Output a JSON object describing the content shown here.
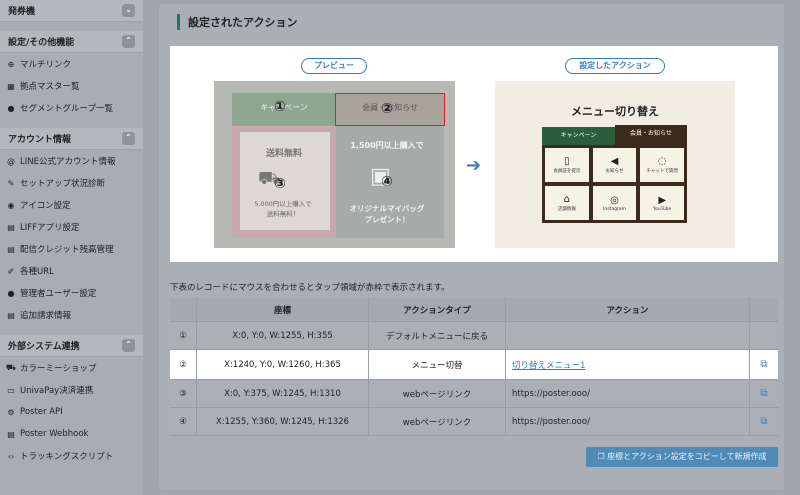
{
  "sidebar": {
    "sec_finance": {
      "label": "発券機"
    },
    "sec_settings": {
      "label": "設定/その他機能"
    },
    "settings_items": [
      {
        "label": "マルチリンク",
        "icon": "globe-icon"
      },
      {
        "label": "拠点マスター覧",
        "icon": "store-icon"
      },
      {
        "label": "セグメントグループ一覧",
        "icon": "users-icon"
      }
    ],
    "sec_account": {
      "label": "アカウント情報"
    },
    "account_items": [
      {
        "label": "LINE公式アカウント情報",
        "icon": "at-icon"
      },
      {
        "label": "セットアップ状況診断",
        "icon": "wrench-icon"
      },
      {
        "label": "アイコン設定",
        "icon": "user-circle-icon"
      },
      {
        "label": "LIFFアプリ設定",
        "icon": "document-icon"
      },
      {
        "label": "配信クレジット残高管理",
        "icon": "document-icon"
      },
      {
        "label": "各種URL",
        "icon": "edit-icon"
      },
      {
        "label": "管理者ユーザー設定",
        "icon": "users-icon"
      },
      {
        "label": "追加請求情報",
        "icon": "invoice-icon"
      }
    ],
    "sec_external": {
      "label": "外部システム連携"
    },
    "external_items": [
      {
        "label": "カラーミーショップ",
        "icon": "cart-icon"
      },
      {
        "label": "UnivaPay決済連携",
        "icon": "card-icon"
      },
      {
        "label": "Poster API",
        "icon": "gear-icon"
      },
      {
        "label": "Poster Webhook",
        "icon": "document-icon"
      },
      {
        "label": "トラッキングスクリプト",
        "icon": "code-icon"
      }
    ]
  },
  "main": {
    "title": "設定されたアクション",
    "preview_label": "プレビュー",
    "action_label": "設定したアクション",
    "preview": {
      "tab_left": "キャンペーン",
      "tab_right": "会員・お知らせ",
      "num1": "①",
      "num2": "②",
      "num3": "③",
      "num4": "④",
      "left_title": "送料無料",
      "left_sub": "5,000円以上購入で\n送料無料！",
      "right_title": "1,500円以上購入で",
      "right_sub": "オリジナルマイバッグ\nプレゼント！"
    },
    "menu": {
      "title": "メニュー切り替え",
      "tab_left": "キャンペーン",
      "tab_right": "会員・お知らせ",
      "cells": [
        {
          "label": "会員証を提示",
          "icon": "phone-icon"
        },
        {
          "label": "お知らせ",
          "icon": "megaphone-icon"
        },
        {
          "label": "チャットで質問",
          "icon": "chat-icon"
        },
        {
          "label": "店舗情報",
          "icon": "store-icon"
        },
        {
          "label": "Instagram",
          "icon": "instagram-icon"
        },
        {
          "label": "YouTube",
          "icon": "youtube-icon"
        }
      ]
    },
    "table_note": "下表のレコードにマウスを合わせるとタップ領域が赤枠で表示されます。",
    "table": {
      "headers": [
        "",
        "座標",
        "アクションタイプ",
        "アクション",
        ""
      ],
      "rows": [
        {
          "no": "①",
          "coord": "X:0, Y:0, W:1255, H:355",
          "type": "デフォルトメニューに戻る",
          "action": ""
        },
        {
          "no": "②",
          "coord": "X:1240, Y:0, W:1260, H:365",
          "type": "メニュー切替",
          "action": "切り替えメニュー1"
        },
        {
          "no": "③",
          "coord": "X:0, Y:375, W:1245, H:1310",
          "type": "webページリンク",
          "action": "https://poster.ooo/"
        },
        {
          "no": "④",
          "coord": "X:1255, Y:360, W:1245, H:1326",
          "type": "webページリンク",
          "action": "https://poster.ooo/"
        }
      ]
    },
    "copy_button": "座標とアクション設定をコピーして新規作成"
  },
  "colors": {
    "accent": "#3a7bbf",
    "title_bar": "#1e7a5a",
    "highlight_frame": "#e02020"
  }
}
